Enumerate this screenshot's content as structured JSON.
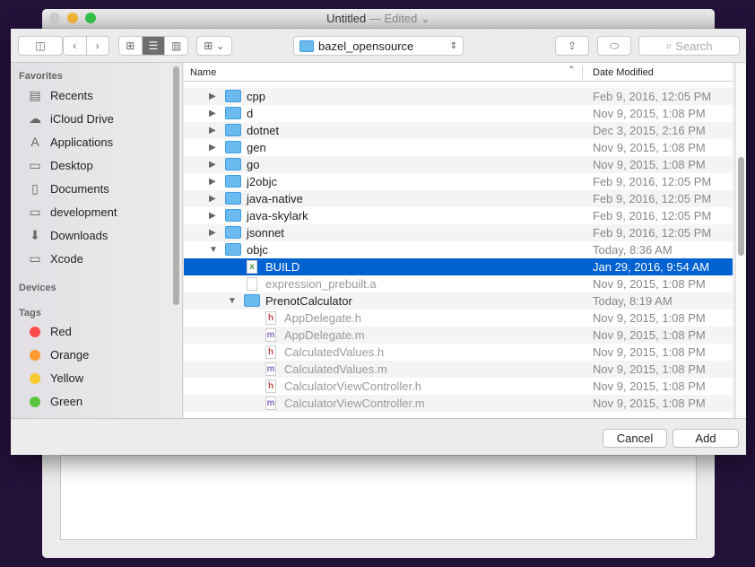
{
  "window": {
    "title": "Untitled",
    "edited": "— Edited ⌄"
  },
  "toolbar": {
    "location": "bazel_opensource",
    "search_placeholder": "Search"
  },
  "sidebar": {
    "favorites_header": "Favorites",
    "favorites": [
      {
        "label": "Recents",
        "icon": "recents-icon"
      },
      {
        "label": "iCloud Drive",
        "icon": "cloud-icon"
      },
      {
        "label": "Applications",
        "icon": "applications-icon"
      },
      {
        "label": "Desktop",
        "icon": "desktop-icon"
      },
      {
        "label": "Documents",
        "icon": "documents-icon"
      },
      {
        "label": "development",
        "icon": "folder-icon"
      },
      {
        "label": "Downloads",
        "icon": "downloads-icon"
      },
      {
        "label": "Xcode",
        "icon": "folder-icon"
      }
    ],
    "devices_header": "Devices",
    "tags_header": "Tags",
    "tags": [
      {
        "label": "Red",
        "color": "#fc4d4a"
      },
      {
        "label": "Orange",
        "color": "#fd9a2f"
      },
      {
        "label": "Yellow",
        "color": "#f8cb2e"
      },
      {
        "label": "Green",
        "color": "#5ac53e"
      }
    ]
  },
  "list": {
    "col_name": "Name",
    "col_date": "Date Modified",
    "rows": [
      {
        "name": "cpp",
        "date": "Feb 9, 2016, 12:05 PM",
        "level": 0,
        "type": "folder",
        "disc": "closed"
      },
      {
        "name": "d",
        "date": "Nov 9, 2015, 1:08 PM",
        "level": 0,
        "type": "folder",
        "disc": "closed"
      },
      {
        "name": "dotnet",
        "date": "Dec 3, 2015, 2:16 PM",
        "level": 0,
        "type": "folder",
        "disc": "closed"
      },
      {
        "name": "gen",
        "date": "Nov 9, 2015, 1:08 PM",
        "level": 0,
        "type": "folder",
        "disc": "closed"
      },
      {
        "name": "go",
        "date": "Nov 9, 2015, 1:08 PM",
        "level": 0,
        "type": "folder",
        "disc": "closed"
      },
      {
        "name": "j2objc",
        "date": "Feb 9, 2016, 12:05 PM",
        "level": 0,
        "type": "folder",
        "disc": "closed"
      },
      {
        "name": "java-native",
        "date": "Feb 9, 2016, 12:05 PM",
        "level": 0,
        "type": "folder",
        "disc": "closed"
      },
      {
        "name": "java-skylark",
        "date": "Feb 9, 2016, 12:05 PM",
        "level": 0,
        "type": "folder",
        "disc": "closed"
      },
      {
        "name": "jsonnet",
        "date": "Feb 9, 2016, 12:05 PM",
        "level": 0,
        "type": "folder",
        "disc": "closed"
      },
      {
        "name": "objc",
        "date": "Today, 8:36 AM",
        "level": 0,
        "type": "folder",
        "disc": "open"
      },
      {
        "name": "BUILD",
        "date": "Jan 29, 2016, 9:54 AM",
        "level": 1,
        "type": "build",
        "disc": "none",
        "selected": true
      },
      {
        "name": "expression_prebuilt.a",
        "date": "Nov 9, 2015, 1:08 PM",
        "level": 1,
        "type": "file",
        "disc": "none",
        "dim": true
      },
      {
        "name": "PrenotCalculator",
        "date": "Today, 8:19 AM",
        "level": 1,
        "type": "folder",
        "disc": "open"
      },
      {
        "name": "AppDelegate.h",
        "date": "Nov 9, 2015, 1:08 PM",
        "level": 2,
        "type": "h",
        "disc": "none",
        "dim": true
      },
      {
        "name": "AppDelegate.m",
        "date": "Nov 9, 2015, 1:08 PM",
        "level": 2,
        "type": "m",
        "disc": "none",
        "dim": true
      },
      {
        "name": "CalculatedValues.h",
        "date": "Nov 9, 2015, 1:08 PM",
        "level": 2,
        "type": "h",
        "disc": "none",
        "dim": true
      },
      {
        "name": "CalculatedValues.m",
        "date": "Nov 9, 2015, 1:08 PM",
        "level": 2,
        "type": "m",
        "disc": "none",
        "dim": true
      },
      {
        "name": "CalculatorViewController.h",
        "date": "Nov 9, 2015, 1:08 PM",
        "level": 2,
        "type": "h",
        "disc": "none",
        "dim": true
      },
      {
        "name": "CalculatorViewController.m",
        "date": "Nov 9, 2015, 1:08 PM",
        "level": 2,
        "type": "m",
        "disc": "none",
        "dim": true
      }
    ]
  },
  "buttons": {
    "cancel": "Cancel",
    "add": "Add"
  },
  "colors": {
    "selection": "#0062d1",
    "folder": "#6cbbf0",
    "background": "#24113a"
  }
}
